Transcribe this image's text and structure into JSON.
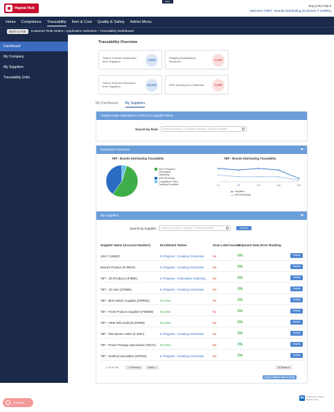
{
  "app": {
    "logo_text": "Haptai Hub",
    "top_badge": "Alerts",
    "top_right_line1": "Eng (US)   Help ▾",
    "top_right_line2": "Welcome (TBP) - Brands Distributing (Customer # 129901)"
  },
  "nav": {
    "items": [
      "Home",
      "Compliance",
      "Traceability",
      "Item & Cost",
      "Quality & Safety",
      "Admin Menu"
    ],
    "active_index": 2
  },
  "subnav": {
    "back_label": "Back to Hub",
    "path": "Customer Role Select › Application Selection › Traceability Dashboard"
  },
  "sidebar": {
    "items": [
      "Dashboard",
      "My Company",
      "My Suppliers",
      "Traceability Units"
    ],
    "active_index": 0,
    "contact_label": "Contact"
  },
  "overview": {
    "title": "Traceability Overview",
    "cards": [
      {
        "label": "Total # of Active Distribution Item Suppliers",
        "value": "2,800",
        "tone": "blue"
      },
      {
        "label": "Shipping Notifications Received",
        "value": "1,002",
        "tone": "pink"
      },
      {
        "label": "Total # of Events Received from Suppliers",
        "value": "12,021",
        "tone": "blue"
      },
      {
        "label": "KDE Scoring Error Detected",
        "value": "7,000",
        "tone": "pink"
      }
    ]
  },
  "tabs": [
    "My Dashboard",
    "My Suppliers"
  ],
  "tabs_active_index": 1,
  "search_panel": {
    "header": "Analyze Data Submission (ASN) for a supplier below",
    "label": "Search by Role:",
    "placeholder": "Search by name / Customer Number / Supplier Number"
  },
  "dashboard_panel": {
    "header": "Dashboard Overview",
    "pie_title": "TBP - Brands Distributing Traceability",
    "line_title": "TBP - Brands Distributing Traceability",
    "pie_legend": [
      "Not in Program / Information Gathering",
      "ASN Receiving",
      "Compliance Level / Tracking Complete"
    ],
    "line_legend": [
      "Suppliers",
      "Item Receiving"
    ]
  },
  "suppliers_panel": {
    "header": "My Suppliers",
    "search_label": "Search by Supplier:",
    "search_placeholder": "Search by name, Customer, Product Number",
    "search_button": "Search",
    "columns": [
      "Supplier Name (Account Number)",
      "Enrollment Status",
      "Scan Label Issues",
      "Shipment Data Error Ranking"
    ],
    "rows": [
      {
        "name": "JMA # (1982E)",
        "status": "In Progress - Creating Connection",
        "status_tone": "blue",
        "issue": "No",
        "pct": "0%",
        "btn": "Details"
      },
      {
        "name": "Brand's Produce (R 89ZIS)",
        "status": "In Progress - Creating Connection",
        "status_tone": "blue",
        "issue": "No",
        "pct": "0%",
        "btn": "Details"
      },
      {
        "name": "TBT - JD (Producer) (F9MD)",
        "status": "In Progress - Information Gathering",
        "status_tone": "blue",
        "issue": "No",
        "pct": "0%",
        "btn": "Details"
      },
      {
        "name": "TBT - JD Ham (Z7899C)",
        "status": "In Progress - Creating Connection",
        "status_tone": "blue",
        "issue": "No",
        "pct": "0%",
        "btn": "Details"
      },
      {
        "name": "TBT - Blok Salsa's Supplies (ZIPRED)",
        "status": "Enrolled",
        "status_tone": "green",
        "issue": "No",
        "pct": "0%",
        "btn": "Details"
      },
      {
        "name": "TBT - Fresh Produce Suppliers (FMNBB)",
        "status": "Enrolled",
        "status_tone": "green",
        "issue": "No",
        "pct": "0%",
        "btn": "Details"
      },
      {
        "name": "TBT - HRM Wild Seafood (F9R98)",
        "status": "Enrolled",
        "status_tone": "green",
        "issue": "No",
        "pct": "0%",
        "btn": "Details"
      },
      {
        "name": "TBT - Mini Banner Sales (Z 3H67)",
        "status": "In Progress - Creating Connection",
        "status_tone": "blue",
        "issue": "No",
        "pct": "0%",
        "btn": "Details"
      },
      {
        "name": "TBT - Primal Package Specialized (7BZ73)",
        "status": "Enrolled",
        "status_tone": "green",
        "issue": "No",
        "pct": "0%",
        "btn": "Details"
      },
      {
        "name": "TBT - Seafood Specialties (ZIP6S4)",
        "status": "In Progress - Creating Connection",
        "status_tone": "blue",
        "issue": "No",
        "pct": "0%",
        "btn": "Details"
      }
    ],
    "pager_info": "1-10 of 100",
    "prev_label": "< Previous",
    "next_label": "Next >",
    "rows_select": "10 Rows ▾",
    "export_label": "Export Filtered Data to Excel"
  },
  "footer": {
    "brand_line1": "Powered by Haptai",
    "brand_line2": "Haptai Group"
  },
  "chart_data": [
    {
      "type": "pie",
      "title": "TBP - Brands Distributing Traceability",
      "categories": [
        "Not in Program / Information Gathering",
        "ASN Receiving",
        "Compliance Level / Tracking Complete"
      ],
      "values": [
        55,
        40,
        5
      ],
      "colors": [
        "#3fae49",
        "#2b6cc4",
        "#6dc6e8"
      ]
    },
    {
      "type": "line",
      "title": "TBP - Brands Distributing Traceability",
      "x": [
        "1/1",
        "1/8",
        "1/15",
        "1/22",
        "1/29"
      ],
      "series": [
        {
          "name": "Suppliers",
          "values": [
            8,
            7,
            8,
            7,
            2
          ],
          "color": "#2b6cc4"
        },
        {
          "name": "Item Receiving",
          "values": [
            4,
            3,
            3,
            3,
            1
          ],
          "color": "#9ab6e3"
        }
      ],
      "ylim": [
        0,
        10
      ]
    }
  ]
}
